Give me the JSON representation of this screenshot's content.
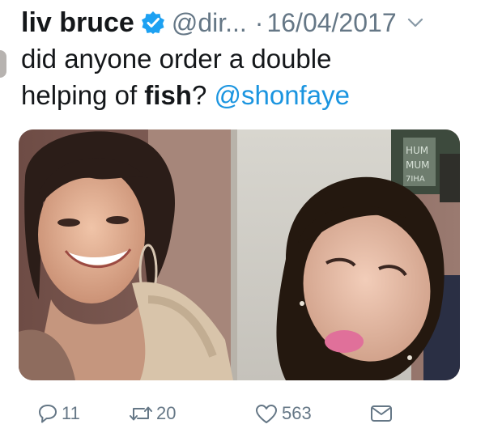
{
  "tweet": {
    "author_name": "liv bruce",
    "handle": "@dir...",
    "separator": "·",
    "date": "16/04/2017",
    "text_line1": "did anyone order a double",
    "text_line2_prefix": "helping of ",
    "text_bold": "fish",
    "text_after_bold": "? ",
    "mention": "@shonfaye"
  },
  "media": {
    "sign_lines": [
      "HUM",
      "MUM",
      "7IHA"
    ]
  },
  "actions": {
    "reply_count": "11",
    "retweet_count": "20",
    "like_count": "563"
  },
  "colors": {
    "verified": "#1da1f2",
    "mention": "#1b95e0",
    "muted": "#657786"
  }
}
